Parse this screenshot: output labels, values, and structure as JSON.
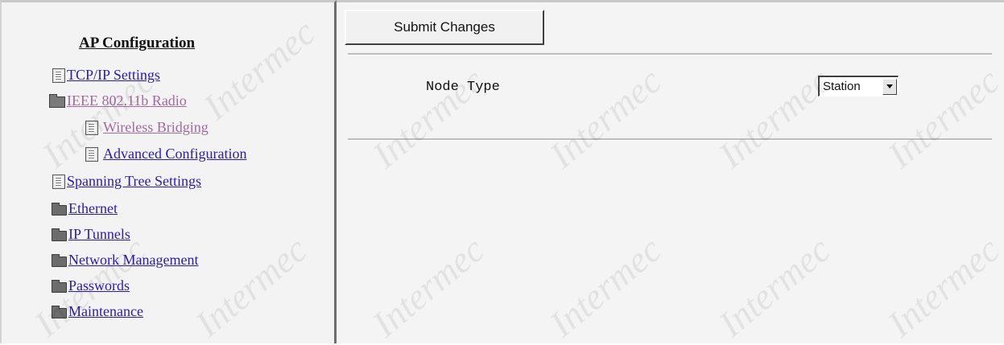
{
  "nav": {
    "title": "AP Configuration",
    "items": [
      {
        "label": "TCP/IP Settings",
        "icon": "document-icon",
        "visited": false
      },
      {
        "label": "IEEE 802.11b Radio",
        "icon": "open-folder-icon",
        "visited": true
      },
      {
        "label": "Wireless Bridging",
        "icon": "document-icon",
        "visited": true
      },
      {
        "label": "Advanced Configuration",
        "icon": "document-icon",
        "visited": false
      },
      {
        "label": "Spanning Tree Settings",
        "icon": "document-icon",
        "visited": false
      },
      {
        "label": "Ethernet",
        "icon": "folder-icon",
        "visited": false
      },
      {
        "label": "IP Tunnels",
        "icon": "folder-icon",
        "visited": false
      },
      {
        "label": "Network Management",
        "icon": "folder-icon",
        "visited": false
      },
      {
        "label": "Passwords",
        "icon": "folder-icon",
        "visited": false
      },
      {
        "label": "Maintenance",
        "icon": "folder-icon",
        "visited": false
      }
    ]
  },
  "main": {
    "submit_label": "Submit Changes",
    "node_type_label": "Node Type",
    "node_type_value": "Station"
  },
  "watermark": "Intermec",
  "colors": {
    "link": "#2b1bb4",
    "visited_link": "#a36aa0",
    "background": "#f4f4f4"
  }
}
